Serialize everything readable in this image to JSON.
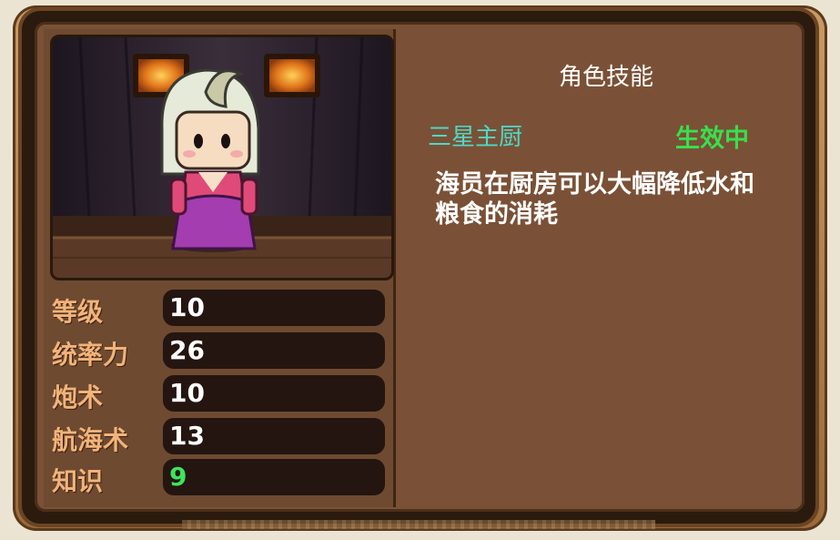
{
  "character": {
    "portrait_icon": "chef-girl-character-portrait"
  },
  "stats": [
    {
      "label": "等级",
      "value": "10",
      "value_color": "#ffffff"
    },
    {
      "label": "统率力",
      "value": "26",
      "value_color": "#ffffff"
    },
    {
      "label": "炮术",
      "value": "10",
      "value_color": "#ffffff"
    },
    {
      "label": "航海术",
      "value": "13",
      "value_color": "#ffffff"
    },
    {
      "label": "知识",
      "value": "9",
      "value_color": "#3de55a"
    }
  ],
  "skill": {
    "header": "角色技能",
    "name": "三星主厨",
    "status": "生效中",
    "description": "海员在厨房可以大幅降低水和粮食的消耗"
  },
  "colors": {
    "label": "#f2b37a",
    "skill_name": "#4fd8c8",
    "status": "#38e04c",
    "panel": "#7a5136"
  }
}
